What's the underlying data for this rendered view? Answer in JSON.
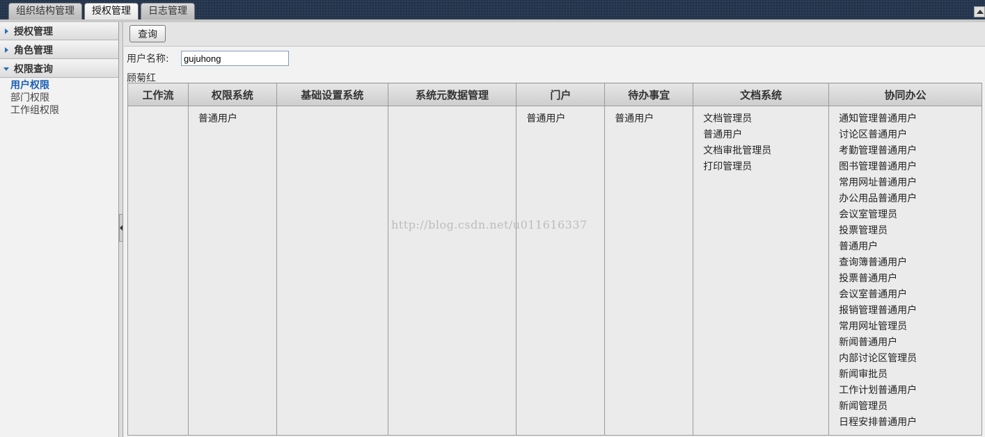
{
  "top_tabs": [
    {
      "label": "组织结构管理",
      "active": false
    },
    {
      "label": "授权管理",
      "active": true
    },
    {
      "label": "日志管理",
      "active": false
    }
  ],
  "sidebar": {
    "sections": [
      {
        "label": "授权管理",
        "expanded": false
      },
      {
        "label": "角色管理",
        "expanded": false
      },
      {
        "label": "权限查询",
        "expanded": true
      }
    ],
    "sub_items": [
      {
        "label": "用户权限",
        "active": true
      },
      {
        "label": "部门权限",
        "active": false
      },
      {
        "label": "工作组权限",
        "active": false
      }
    ]
  },
  "toolbar": {
    "query_label": "查询"
  },
  "form": {
    "username_label": "用户名称:",
    "username_value": "gujuhong"
  },
  "real_name": "顾菊红",
  "table": {
    "headers": [
      "工作流",
      "权限系统",
      "基础设置系统",
      "系统元数据管理",
      "门户",
      "待办事宜",
      "文档系统",
      "协同办公"
    ],
    "cells": [
      [],
      [
        "普通用户"
      ],
      [],
      [],
      [
        "普通用户"
      ],
      [
        "普通用户"
      ],
      [
        "文档管理员",
        "普通用户",
        "文档审批管理员",
        "打印管理员"
      ],
      [
        "通知管理普通用户",
        "讨论区普通用户",
        "考勤管理普通用户",
        "图书管理普通用户",
        "常用网址普通用户",
        "办公用品普通用户",
        "会议室管理员",
        "投票管理员",
        "普通用户",
        "查询簿普通用户",
        "投票普通用户",
        "会议室普通用户",
        "报销管理普通用户",
        "常用网址管理员",
        "新闻普通用户",
        "内部讨论区管理员",
        "新闻审批员",
        "工作计划普通用户",
        "新闻管理员",
        "日程安排普通用户"
      ]
    ]
  },
  "watermark": "http://blog.csdn.net/u011616337"
}
